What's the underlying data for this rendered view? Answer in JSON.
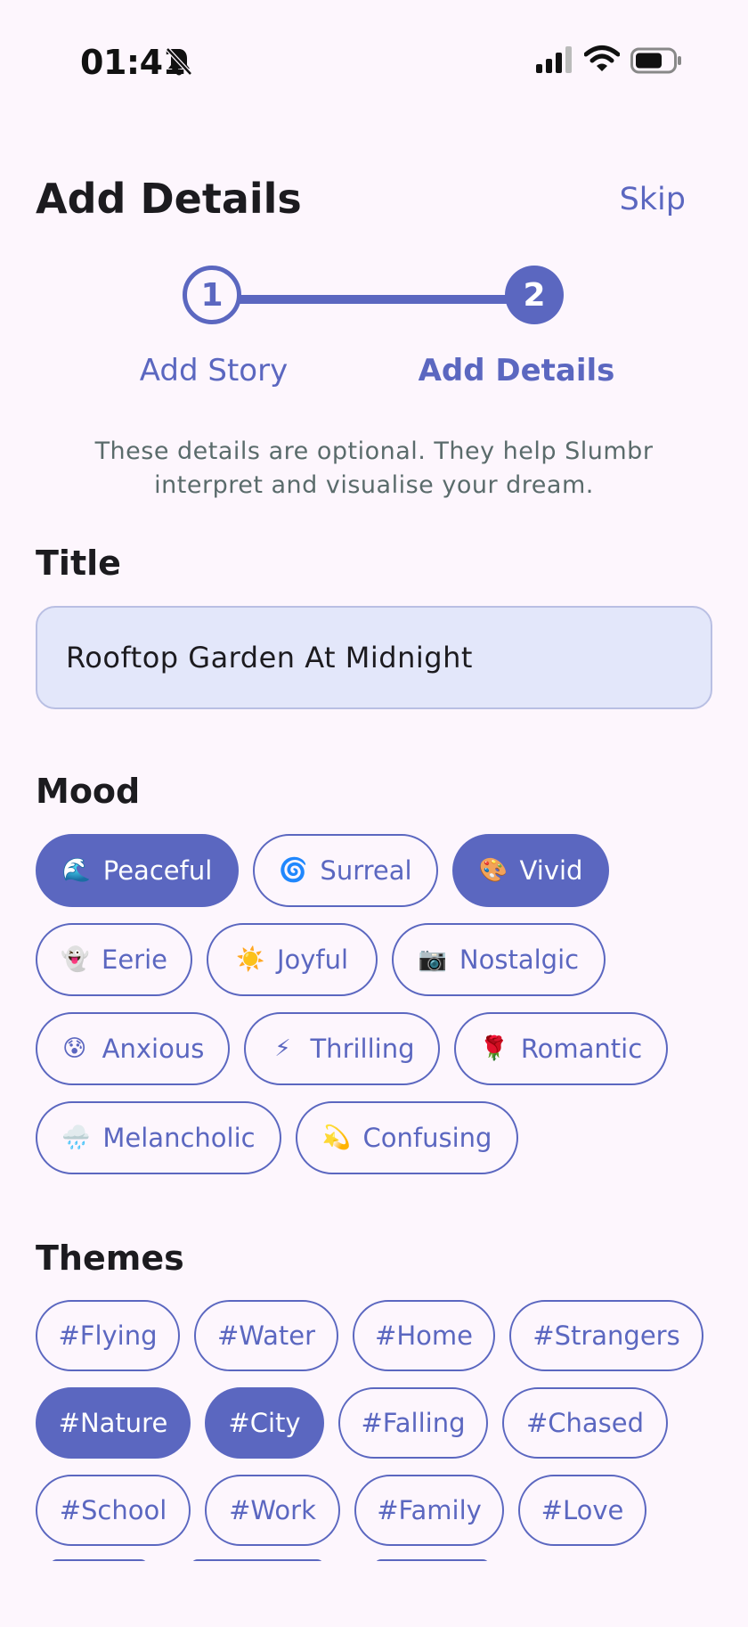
{
  "status_bar": {
    "time": "01:41",
    "icons": [
      "bell-slash-icon",
      "cellular-signal-icon",
      "wifi-icon",
      "battery-icon"
    ]
  },
  "header": {
    "title": "Add Details",
    "skip_label": "Skip"
  },
  "stepper": {
    "steps": [
      {
        "number": "1",
        "label": "Add Story",
        "state": "done"
      },
      {
        "number": "2",
        "label": "Add Details",
        "state": "active"
      }
    ]
  },
  "helper_text": "These details are optional. They help Slumbr interpret and visualise your dream.",
  "title_section": {
    "label": "Title",
    "value": "Rooftop Garden At Midnight"
  },
  "mood_section": {
    "label": "Mood",
    "chips": [
      {
        "emoji": "🌊",
        "label": "Peaceful",
        "selected": true
      },
      {
        "emoji": "🌀",
        "label": "Surreal",
        "selected": false
      },
      {
        "emoji": "🎨",
        "label": "Vivid",
        "selected": true
      },
      {
        "emoji": "👻",
        "label": "Eerie",
        "selected": false
      },
      {
        "emoji": "☀️",
        "label": "Joyful",
        "selected": false
      },
      {
        "emoji": "📷",
        "label": "Nostalgic",
        "selected": false
      },
      {
        "emoji": "😰",
        "label": "Anxious",
        "selected": false
      },
      {
        "emoji": "⚡",
        "label": "Thrilling",
        "selected": false
      },
      {
        "emoji": "🌹",
        "label": "Romantic",
        "selected": false
      },
      {
        "emoji": "🌧️",
        "label": "Melancholic",
        "selected": false
      },
      {
        "emoji": "💫",
        "label": "Confusing",
        "selected": false
      }
    ]
  },
  "themes_section": {
    "label": "Themes",
    "chips": [
      {
        "label": "#Flying",
        "selected": false
      },
      {
        "label": "#Water",
        "selected": false
      },
      {
        "label": "#Home",
        "selected": false
      },
      {
        "label": "#Strangers",
        "selected": false
      },
      {
        "label": "#Nature",
        "selected": true
      },
      {
        "label": "#City",
        "selected": true
      },
      {
        "label": "#Falling",
        "selected": false
      },
      {
        "label": "#Chased",
        "selected": false
      },
      {
        "label": "#School",
        "selected": false
      },
      {
        "label": "#Work",
        "selected": false
      },
      {
        "label": "#Family",
        "selected": false
      },
      {
        "label": "#Love",
        "selected": false
      }
    ]
  },
  "colors": {
    "accent": "#5b67c0",
    "background": "#fdf6fd",
    "input_fill": "#e3e7fa",
    "helper_text": "#5a6b6b"
  }
}
